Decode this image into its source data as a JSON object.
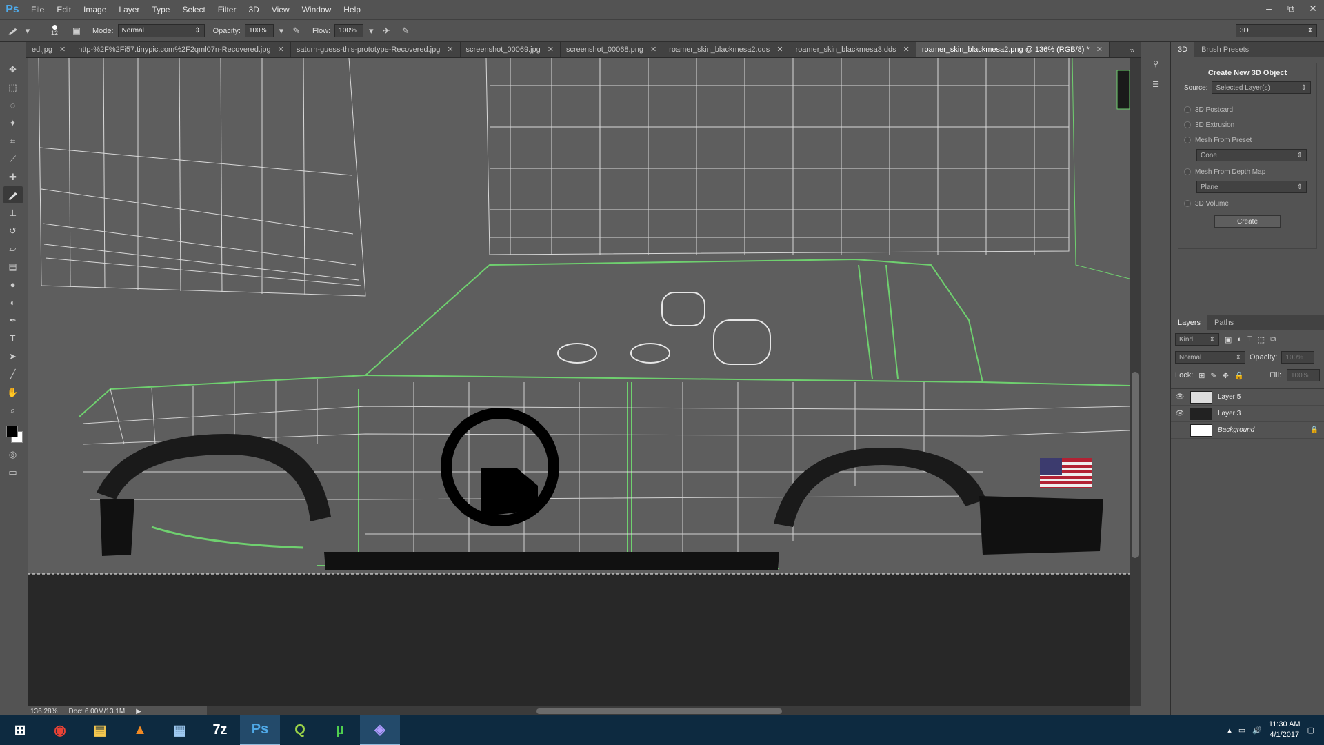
{
  "app": {
    "logo": "Ps"
  },
  "menu": [
    "File",
    "Edit",
    "Image",
    "Layer",
    "Type",
    "Select",
    "Filter",
    "3D",
    "View",
    "Window",
    "Help"
  ],
  "window_controls": [
    "–",
    "⧉",
    "✕"
  ],
  "options": {
    "brush_size": "12",
    "mode_label": "Mode:",
    "mode_value": "Normal",
    "opacity_label": "Opacity:",
    "opacity_value": "100%",
    "flow_label": "Flow:",
    "flow_value": "100%",
    "workspace": "3D"
  },
  "tabs": [
    {
      "name": "ed.jpg",
      "active": false
    },
    {
      "name": "http-%2F%2Fi57.tinypic.com%2F2qml07n-Recovered.jpg",
      "active": false
    },
    {
      "name": "saturn-guess-this-prototype-Recovered.jpg",
      "active": false
    },
    {
      "name": "screenshot_00069.jpg",
      "active": false
    },
    {
      "name": "screenshot_00068.png",
      "active": false
    },
    {
      "name": "roamer_skin_blackmesa2.dds",
      "active": false
    },
    {
      "name": "roamer_skin_blackmesa3.dds",
      "active": false
    },
    {
      "name": "roamer_skin_blackmesa2.png @ 136% (RGB/8) *",
      "active": true
    }
  ],
  "status": {
    "zoom": "136.28%",
    "doc": "Doc: 6.00M/13.1M"
  },
  "panel3d": {
    "tabs": [
      "3D",
      "Brush Presets"
    ],
    "title": "Create New 3D Object",
    "source_label": "Source:",
    "source_value": "Selected Layer(s)",
    "options": [
      "3D Postcard",
      "3D Extrusion",
      "Mesh From Preset",
      "Mesh From Depth Map",
      "3D Volume"
    ],
    "preset_value": "Cone",
    "depth_value": "Plane",
    "create_button": "Create"
  },
  "layers_panel": {
    "tabs": [
      "Layers",
      "Paths"
    ],
    "kind": "Kind",
    "blend": "Normal",
    "opacity_label": "Opacity:",
    "opacity_value": "100%",
    "lock_label": "Lock:",
    "fill_label": "Fill:",
    "fill_value": "100%",
    "layers": [
      {
        "name": "Layer 5",
        "visible": true
      },
      {
        "name": "Layer 3",
        "visible": true
      },
      {
        "name": "Background",
        "visible": false,
        "locked": true
      }
    ]
  },
  "taskbar": {
    "apps": [
      "Windows",
      "Chrome",
      "File Explorer",
      "Avast",
      "Remote",
      "7z",
      "Ps",
      "Qt",
      "uTorrent",
      "Steam"
    ],
    "time": "11:30 AM",
    "date": "4/1/2017"
  },
  "colors": {
    "accent": "#4fa9e8",
    "wire": "#e6e6e6",
    "wire_green": "#6fd06f",
    "taskbar": "#0d2a40"
  }
}
